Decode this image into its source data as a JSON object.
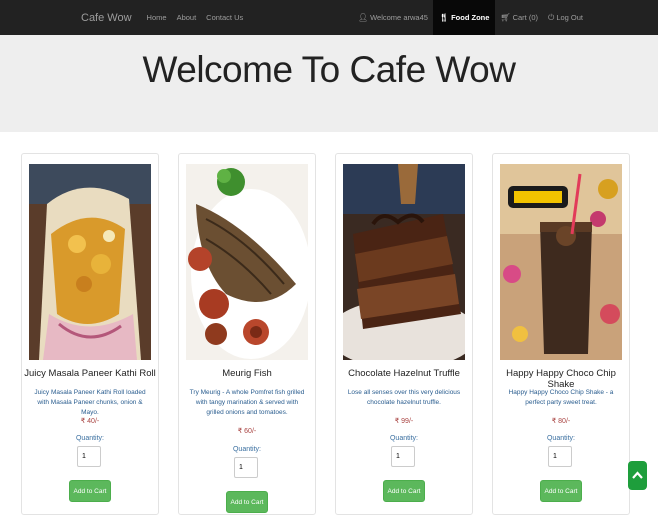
{
  "nav": {
    "brand": "Cafe Wow",
    "links": [
      "Home",
      "About",
      "Contact Us"
    ],
    "welcome": "Welcome arwa45",
    "food_zone": "Food Zone",
    "cart": "Cart (0)",
    "logout": "Log Out"
  },
  "hero": {
    "title": "Welcome To Cafe Wow"
  },
  "products": [
    {
      "title": "Juicy Masala Paneer Kathi Roll",
      "desc": "Juicy Masala Paneer Kathi Roll loaded with Masala Paneer chunks, onion & Mayo.",
      "price": "₹ 40/-",
      "qty_label": "Quantity:",
      "qty": "1",
      "button": "Add to Cart"
    },
    {
      "title": "Meurig Fish",
      "desc": "Try Meurig - A whole Pomfret fish grilled with tangy marination & served with grilled onions and tomatoes.",
      "price": "₹ 60/-",
      "qty_label": "Quantity:",
      "qty": "1",
      "button": "Add to Cart"
    },
    {
      "title": "Chocolate Hazelnut Truffle",
      "desc": "Lose all senses over this very delicious chocolate hazelnut truffle.",
      "price": "₹ 99/-",
      "qty_label": "Quantity:",
      "qty": "1",
      "button": "Add to Cart"
    },
    {
      "title": "Happy Happy Choco Chip Shake",
      "desc": "Happy Happy Choco Chip Shake - a perfect party sweet treat.",
      "price": "₹ 80/-",
      "qty_label": "Quantity:",
      "qty": "1",
      "button": "Add to Cart"
    }
  ],
  "colors": {
    "navbar": "#222222",
    "jumbotron": "#eeeeee",
    "button": "#5cb85c",
    "price": "#a94442"
  }
}
